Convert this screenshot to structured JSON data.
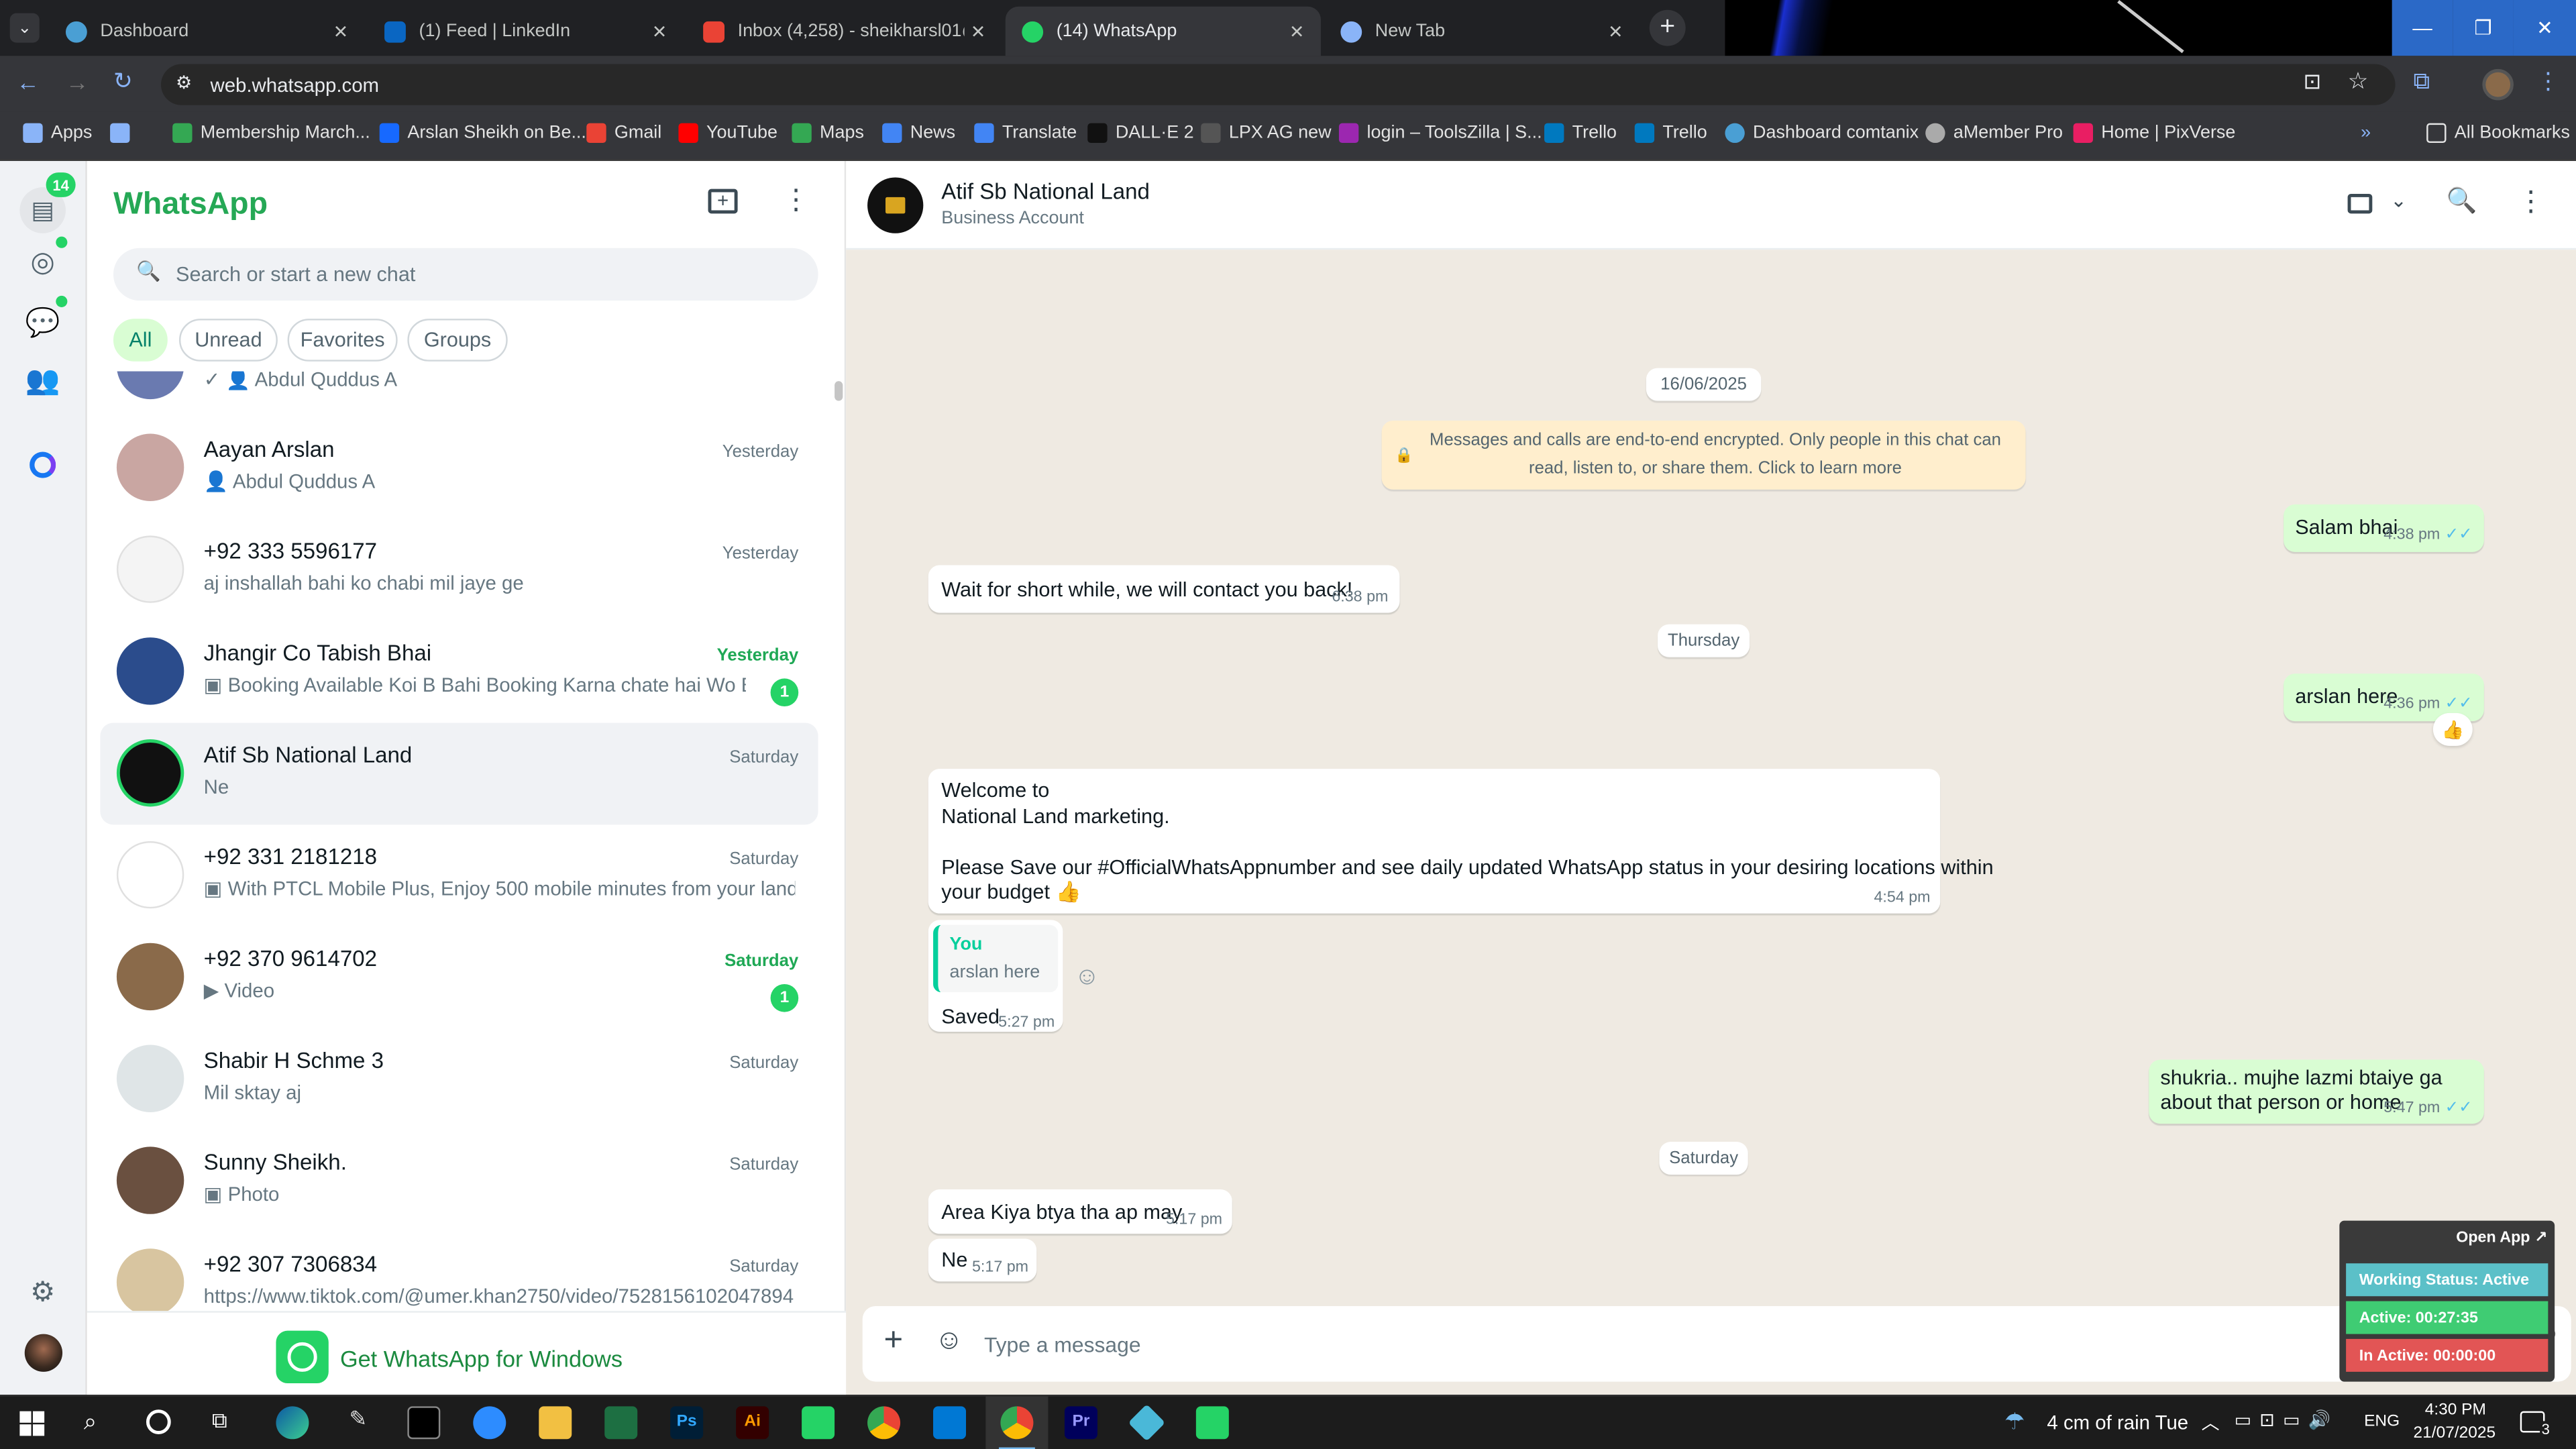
{
  "browser": {
    "tabs": [
      {
        "title": "Dashboard",
        "color": "#4a9fd4"
      },
      {
        "title": "(1) Feed | LinkedIn",
        "color": "#0a66c2"
      },
      {
        "title": "Inbox (4,258) - sheikharsl01@gm",
        "color": "#ea4335"
      },
      {
        "title": "(14) WhatsApp",
        "color": "#25d366"
      },
      {
        "title": "New Tab",
        "color": "#8ab4f8"
      }
    ],
    "url": "web.whatsapp.com",
    "bookmarks": [
      {
        "label": "Apps",
        "color": "#8ab4f8"
      },
      {
        "label": "Membership March...",
        "color": "#34a853"
      },
      {
        "label": "Arslan Sheikh on Be...",
        "color": "#1769ff"
      },
      {
        "label": "Gmail",
        "color": "#ea4335"
      },
      {
        "label": "YouTube",
        "color": "#ff0000"
      },
      {
        "label": "Maps",
        "color": "#34a853"
      },
      {
        "label": "News",
        "color": "#4285f4"
      },
      {
        "label": "Translate",
        "color": "#4285f4"
      },
      {
        "label": "DALL·E 2",
        "color": "#111111"
      },
      {
        "label": "LPX AG new",
        "color": "#555555"
      },
      {
        "label": "login – ToolsZilla | S...",
        "color": "#9c27b0"
      },
      {
        "label": "Trello",
        "color": "#0079bf"
      },
      {
        "label": "Trello",
        "color": "#0079bf"
      },
      {
        "label": "Dashboard comtanix",
        "color": "#4a9fd4"
      },
      {
        "label": "aMember Pro",
        "color": "#aaaaaa"
      },
      {
        "label": "Home | PixVerse",
        "color": "#e91e63"
      }
    ],
    "all_bookmarks": "All Bookmarks"
  },
  "rail": {
    "badge": "14"
  },
  "sidebar": {
    "title": "WhatsApp",
    "search_placeholder": "Search or start a new chat",
    "filters": [
      "All",
      "Unread",
      "Favorites",
      "Groups"
    ],
    "partial_preview": "Abdul Quddus A",
    "chats": [
      {
        "name": "Aayan Arslan",
        "time": "Yesterday",
        "preview": "Abdul Quddus A",
        "icon": "person",
        "badge": "",
        "color": "#c9a6a2"
      },
      {
        "name": "+92 333 5596177",
        "time": "Yesterday",
        "preview": "aj inshallah bahi ko chabi mil jaye ge",
        "icon": "",
        "badge": "",
        "color": "#f4f4f4"
      },
      {
        "name": "Jhangir Co Tabish Bhai",
        "time": "Yesterday",
        "preview": "Booking  Available  Koi B Bahi Booking Karna chate hai  Wo Bo...",
        "icon": "photo",
        "badge": "1",
        "color": "#2b4c8c"
      },
      {
        "name": "Atif Sb National Land",
        "time": "Saturday",
        "preview": "Ne",
        "icon": "",
        "badge": "",
        "color": "#111111"
      },
      {
        "name": "+92 331 2181218",
        "time": "Saturday",
        "preview": "With PTCL Mobile Plus, Enjoy 500 mobile minutes from your landl...",
        "icon": "photo",
        "badge": "",
        "color": "#ffffff"
      },
      {
        "name": "+92 370 9614702",
        "time": "Saturday",
        "preview": "Video",
        "icon": "video",
        "badge": "1",
        "color": "#8a6a4a"
      },
      {
        "name": "Shabir H  Schme 3",
        "time": "Saturday",
        "preview": "Mil sktay aj",
        "icon": "",
        "badge": "",
        "color": "#dfe5e7"
      },
      {
        "name": "Sunny Sheikh.",
        "time": "Saturday",
        "preview": "Photo",
        "icon": "photo",
        "badge": "",
        "color": "#6a5040"
      },
      {
        "name": "+92 307 7306834",
        "time": "Saturday",
        "preview": "https://www.tiktok.com/@umer.khan2750/video/7528156102047894...",
        "icon": "",
        "badge": "",
        "color": "#d8c5a0"
      }
    ],
    "get_app": "Get WhatsApp for Windows"
  },
  "conversation": {
    "name": "Atif Sb National Land",
    "subtitle": "Business Account",
    "date1": "16/06/2025",
    "encryption": "Messages and calls are end-to-end encrypted. Only people in this chat can read, listen to, or share them. Click to learn more",
    "m1": {
      "text": "Salam bhai",
      "time": "4:38 pm"
    },
    "m2": {
      "text": "Wait for short while, we will contact you back!",
      "time": "6:38 pm"
    },
    "date2": "Thursday",
    "m3": {
      "text": "arslan here",
      "time": "4:36 pm",
      "reaction": "👍"
    },
    "m4": {
      "l1": "Welcome to",
      "l2": "National Land marketing.",
      "l3": "Please Save our #OfficialWhatsAppnumber and see daily updated WhatsApp status in your desiring locations within",
      "l4": "your budget 👍",
      "time": "4:54 pm"
    },
    "m5": {
      "quote_author": "You",
      "quote_text": "arslan here",
      "text": "Saved",
      "time": "5:27 pm"
    },
    "m6": {
      "l1": "shukria.. mujhe lazmi btaiye ga",
      "l2": "about that person or home",
      "time": "5:47 pm"
    },
    "date3": "Saturday",
    "m7": {
      "text": "Area Kiya btya tha ap may",
      "time": "5:17 pm"
    },
    "m8": {
      "text": "Ne",
      "time": "5:17 pm"
    },
    "composer_placeholder": "Type a message"
  },
  "widget": {
    "open": "Open App ↗",
    "status": "Working Status: Active",
    "active": "Active: 00:27:35",
    "inactive": "In Active: 00:00:00"
  },
  "taskbar": {
    "weather": "4 cm of rain Tue",
    "lang": "ENG",
    "time": "4:30 PM",
    "date": "21/07/2025",
    "notif": "3"
  }
}
